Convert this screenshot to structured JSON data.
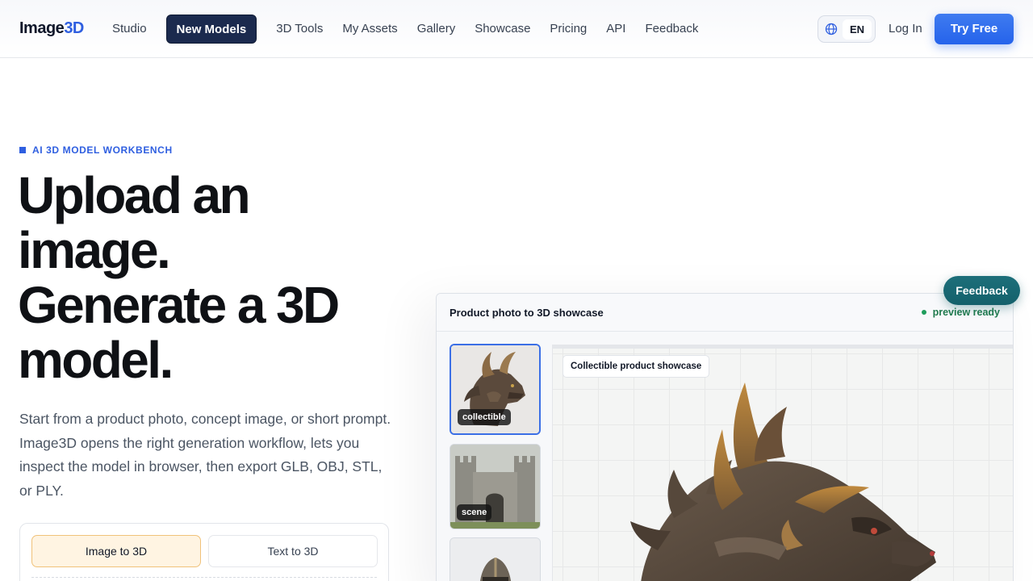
{
  "header": {
    "logo_main": "Image",
    "logo_accent": "3D",
    "nav": [
      {
        "label": "Studio"
      },
      {
        "label": "New Models"
      },
      {
        "label": "3D Tools"
      },
      {
        "label": "My Assets"
      },
      {
        "label": "Gallery"
      },
      {
        "label": "Showcase"
      },
      {
        "label": "Pricing"
      },
      {
        "label": "API"
      },
      {
        "label": "Feedback"
      }
    ],
    "active_nav": "New Models",
    "language": "EN",
    "login_label": "Log In",
    "cta_label": "Try Free"
  },
  "hero": {
    "eyebrow": "AI 3D MODEL WORKBENCH",
    "headline_lines": [
      "Upload an",
      "image.",
      "Generate a 3D",
      "model."
    ],
    "subtext": "Start from a product photo, concept image, or short prompt. Image3D opens the right generation workflow, lets you inspect the model in browser, then export GLB, OBJ, STL, or PLY."
  },
  "mode_tabs": [
    {
      "label": "Image to 3D",
      "selected": true
    },
    {
      "label": "Text to 3D",
      "selected": false
    }
  ],
  "showcase": {
    "title": "Product photo to 3D showcase",
    "status": "preview ready",
    "thumbnails": [
      {
        "tag": "collectible",
        "icon": "dragon-head-thumbnail",
        "selected": true
      },
      {
        "tag": "scene",
        "icon": "castle-gate-thumbnail",
        "selected": false
      },
      {
        "tag": "",
        "icon": "knight-helmet-thumbnail",
        "selected": false
      }
    ],
    "viewer_label": "Collectible product showcase",
    "viewer_model": "dragon-head-model"
  },
  "floating_feedback": "Feedback",
  "colors": {
    "accent": "#2f5fe0",
    "active_nav_bg": "#1b2a4e",
    "cta": "#2563eb",
    "status_green": "#1f7a4d",
    "feedback_fab": "#1d6f7a",
    "selected_tab_bg": "#fff4e2"
  }
}
